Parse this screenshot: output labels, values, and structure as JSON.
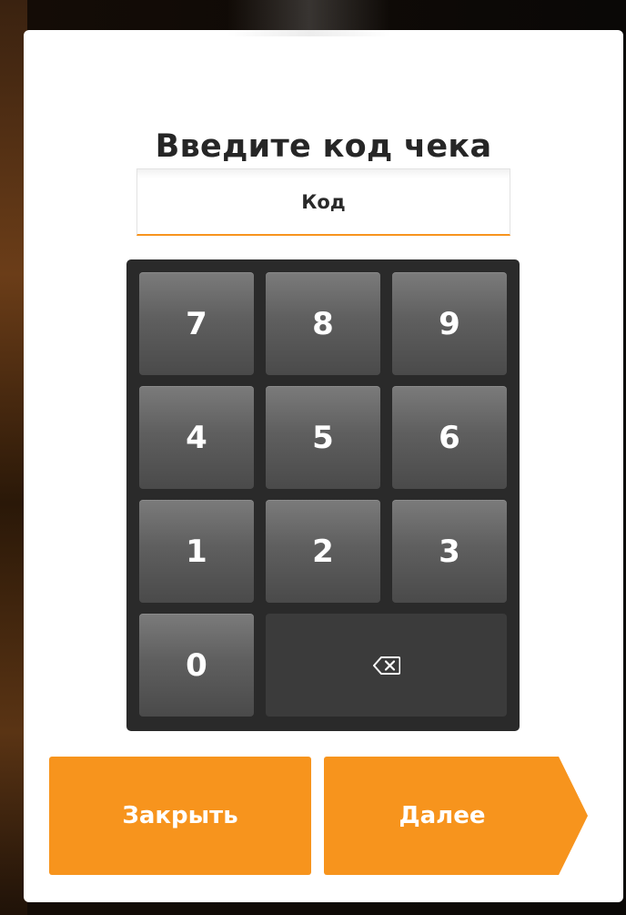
{
  "dialog": {
    "title": "Введите код чека",
    "code_input": {
      "placeholder": "Код",
      "value": ""
    }
  },
  "keypad": {
    "keys": [
      "7",
      "8",
      "9",
      "4",
      "5",
      "6",
      "1",
      "2",
      "3",
      "0"
    ],
    "backspace_icon": "backspace-icon"
  },
  "actions": {
    "close_label": "Закрыть",
    "next_label": "Далее"
  },
  "colors": {
    "accent": "#f7941d",
    "keypad_bg": "#2a2a2a",
    "key_bg": "#5f5f5f"
  }
}
